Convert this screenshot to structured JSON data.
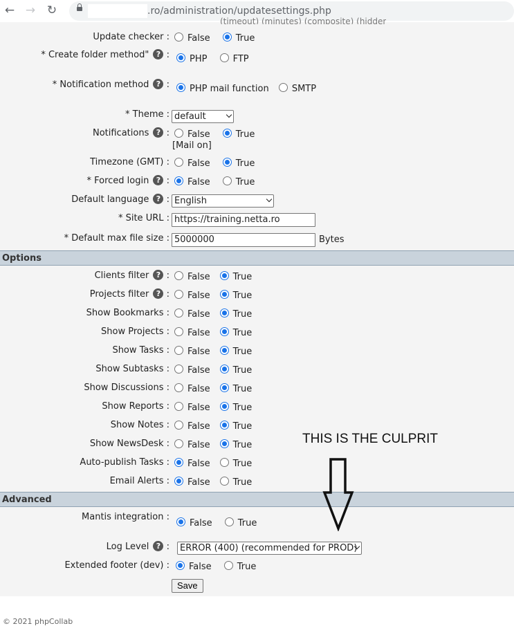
{
  "browser": {
    "url": ".ro/administration/updatesettings.php",
    "back_icon": "←",
    "forward_icon": "→",
    "reload_icon": "↻"
  },
  "general": {
    "update_checker": {
      "label": "Update checker :",
      "options": [
        "False",
        "True"
      ],
      "selected": "True"
    },
    "create_folder_method": {
      "label": "* Create folder method\" ",
      "options": [
        "PHP",
        "FTP"
      ],
      "selected": "PHP"
    },
    "notification_method": {
      "label": "* Notification method ",
      "options": [
        "PHP mail function",
        "SMTP"
      ],
      "selected": "PHP mail function"
    },
    "theme": {
      "label": "* Theme :",
      "value": "default"
    },
    "notifications": {
      "label": "Notifications ",
      "options": [
        "False",
        "True"
      ],
      "selected": "True",
      "note": "[Mail on]"
    },
    "timezone": {
      "label": "Timezone (GMT) :",
      "options": [
        "False",
        "True"
      ],
      "selected": "True"
    },
    "forced_login": {
      "label": "* Forced login ",
      "options": [
        "False",
        "True"
      ],
      "selected": "False"
    },
    "default_language": {
      "label": "Default language ",
      "value": "English"
    },
    "site_url": {
      "label": "* Site URL :",
      "value": "https://training.netta.ro"
    },
    "default_max_file_size": {
      "label": "* Default max file size :",
      "value": "5000000",
      "unit": "Bytes"
    }
  },
  "options": {
    "title": "Options",
    "rows": [
      {
        "label": "Clients filter ",
        "help": true,
        "selected": "True"
      },
      {
        "label": "Projects filter ",
        "help": true,
        "selected": "True"
      },
      {
        "label": "Show Bookmarks :",
        "help": false,
        "selected": "True"
      },
      {
        "label": "Show Projects :",
        "help": false,
        "selected": "True"
      },
      {
        "label": "Show Tasks :",
        "help": false,
        "selected": "True"
      },
      {
        "label": "Show Subtasks :",
        "help": false,
        "selected": "True"
      },
      {
        "label": "Show Discussions :",
        "help": false,
        "selected": "True"
      },
      {
        "label": "Show Reports :",
        "help": false,
        "selected": "True"
      },
      {
        "label": "Show Notes :",
        "help": false,
        "selected": "True"
      },
      {
        "label": "Show NewsDesk :",
        "help": false,
        "selected": "True"
      },
      {
        "label": "Auto-publish Tasks :",
        "help": false,
        "selected": "False"
      },
      {
        "label": "Email Alerts :",
        "help": false,
        "selected": "False"
      }
    ],
    "false_label": "False",
    "true_label": "True"
  },
  "advanced": {
    "title": "Advanced",
    "mantis_integration": {
      "label": "Mantis integration :",
      "options": [
        "False",
        "True"
      ],
      "selected": "False"
    },
    "log_level": {
      "label": "Log Level ",
      "value": "ERROR (400) (recommended for PROD)"
    },
    "extended_footer": {
      "label": "Extended footer (dev) :",
      "options": [
        "False",
        "True"
      ],
      "selected": "False"
    }
  },
  "colon": " :",
  "help_glyph": "?",
  "save_label": "Save",
  "annotation": "THIS IS THE CULPRIT",
  "footer": "© 2021 phpCollab"
}
